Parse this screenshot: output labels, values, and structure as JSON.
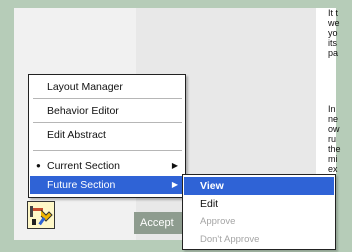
{
  "background_text": {
    "group1": [
      "It t",
      "we",
      "yo",
      "its",
      "pa"
    ],
    "group2": [
      "In",
      "ne",
      "ow",
      "ru",
      "the",
      "mi",
      "ex"
    ]
  },
  "accept_button": {
    "label": "Accept"
  },
  "context_menu": {
    "items": [
      {
        "label": "Layout Manager"
      },
      {
        "label": "Behavior Editor"
      },
      {
        "label": "Edit Abstract"
      },
      {
        "label": "Current Section",
        "arrow": "▶",
        "bullet": "●"
      },
      {
        "label": "Future Section",
        "arrow": "▶"
      }
    ]
  },
  "submenu": {
    "items": [
      {
        "label": "View"
      },
      {
        "label": "Edit"
      },
      {
        "label": "Approve"
      },
      {
        "label": "Don't Approve"
      }
    ]
  },
  "colors": {
    "menu_highlight": "#2f63d6",
    "disabled_text": "#a5a5a5",
    "frame_green": "#b6ccb8"
  },
  "icons": {
    "tool_button": "wrench-screwdriver-icon"
  }
}
